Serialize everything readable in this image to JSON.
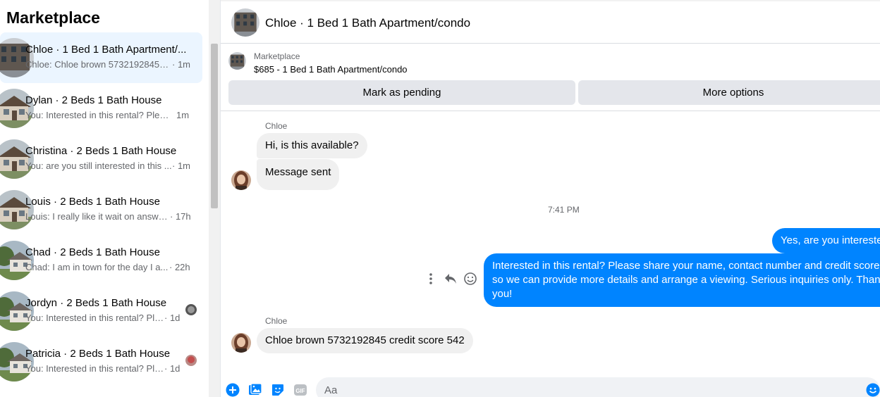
{
  "sidebar": {
    "title": "Marketplace",
    "conversations": [
      {
        "title": "Chloe · 1 Bed 1 Bath Apartment/...",
        "preview": "Chloe: Chloe brown 5732192845 c...",
        "time": "· 1m"
      },
      {
        "title": "Dylan · 2 Beds 1 Bath House",
        "preview": "You: Interested in this rental? Pleas...",
        "time": "1m"
      },
      {
        "title": "Christina · 2 Beds 1 Bath House",
        "preview": "You: are you still interested in this ...",
        "time": "· 1m"
      },
      {
        "title": "Louis · 2 Beds 1 Bath House",
        "preview": "Louis: I really like it wait on answe...",
        "time": "· 17h"
      },
      {
        "title": "Chad · 2 Beds 1 Bath House",
        "preview": "Chad: I am in town for the day I a...",
        "time": "· 22h"
      },
      {
        "title": "Jordyn · 2 Beds 1 Bath House",
        "preview": "You: Interested in this rental? Ple...",
        "time": "· 1d"
      },
      {
        "title": "Patricia · 2 Beds 1 Bath House",
        "preview": "You: Interested in this rental? Ple...",
        "time": "· 1d"
      }
    ]
  },
  "chat": {
    "header_title": "Chloe · 1 Bed 1 Bath Apartment/condo",
    "listing": {
      "source": "Marketplace",
      "description": "$685 - 1 Bed 1 Bath Apartment/condo",
      "pending_label": "Mark as pending",
      "more_label": "More options"
    },
    "messages": {
      "sender_1": "Chloe",
      "in_1": "Hi, is this available?",
      "in_2": "Message sent",
      "timestamp": "7:41 PM",
      "out_1": "Yes, are you interested?",
      "out_2": "Interested in this rental? Please share your name, contact number and credit score so we can provide more details and arrange a viewing. Serious inquiries only. Thank you!",
      "sender_2": "Chloe",
      "in_3": "Chloe brown 5732192845 credit score 542"
    },
    "composer": {
      "placeholder": "Aa"
    }
  },
  "colors": {
    "accent": "#0084ff",
    "active_conversation_bg": "#ebf5ff",
    "incoming_bubble": "#f0f0f0",
    "button_bg": "#e4e6eb"
  },
  "icons": [
    "plus-circle-icon",
    "photo-icon",
    "sticker-icon",
    "gif-icon",
    "emoji-icon",
    "more-vertical-icon",
    "reply-icon",
    "react-icon"
  ]
}
